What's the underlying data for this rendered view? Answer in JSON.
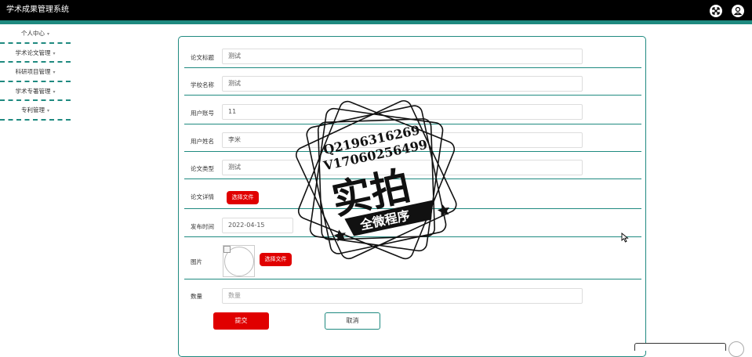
{
  "app": {
    "title": "学术成果管理系统"
  },
  "topbar": {
    "fullscreen_icon": "expand-icon",
    "user_icon": "user-icon"
  },
  "sidebar": {
    "items": [
      {
        "label": "个人中心"
      },
      {
        "label": "学术论文管理"
      },
      {
        "label": "科研项目管理"
      },
      {
        "label": "学术专著管理"
      },
      {
        "label": "专利管理"
      }
    ],
    "caret": "▾"
  },
  "form": {
    "paper_title": {
      "label": "论文标题",
      "value": "测试"
    },
    "school_name": {
      "label": "学校名称",
      "value": "测试"
    },
    "user_account": {
      "label": "用户账号",
      "value": "11"
    },
    "user_name": {
      "label": "用户姓名",
      "value": "李米"
    },
    "paper_type": {
      "label": "论文类型",
      "value": "测试"
    },
    "paper_detail": {
      "label": "论文详情",
      "button": "选择文件"
    },
    "publish_time": {
      "label": "发布时间",
      "value": "2022-04-15"
    },
    "picture": {
      "label": "图片",
      "button": "选择文件"
    },
    "quantity": {
      "label": "数量",
      "placeholder": "数量"
    },
    "submit_label": "提交",
    "cancel_label": "取消"
  },
  "watermark": {
    "line1": "Q2196316269",
    "line2": "V17060256499",
    "big": "实拍",
    "banner": "全微程序"
  }
}
